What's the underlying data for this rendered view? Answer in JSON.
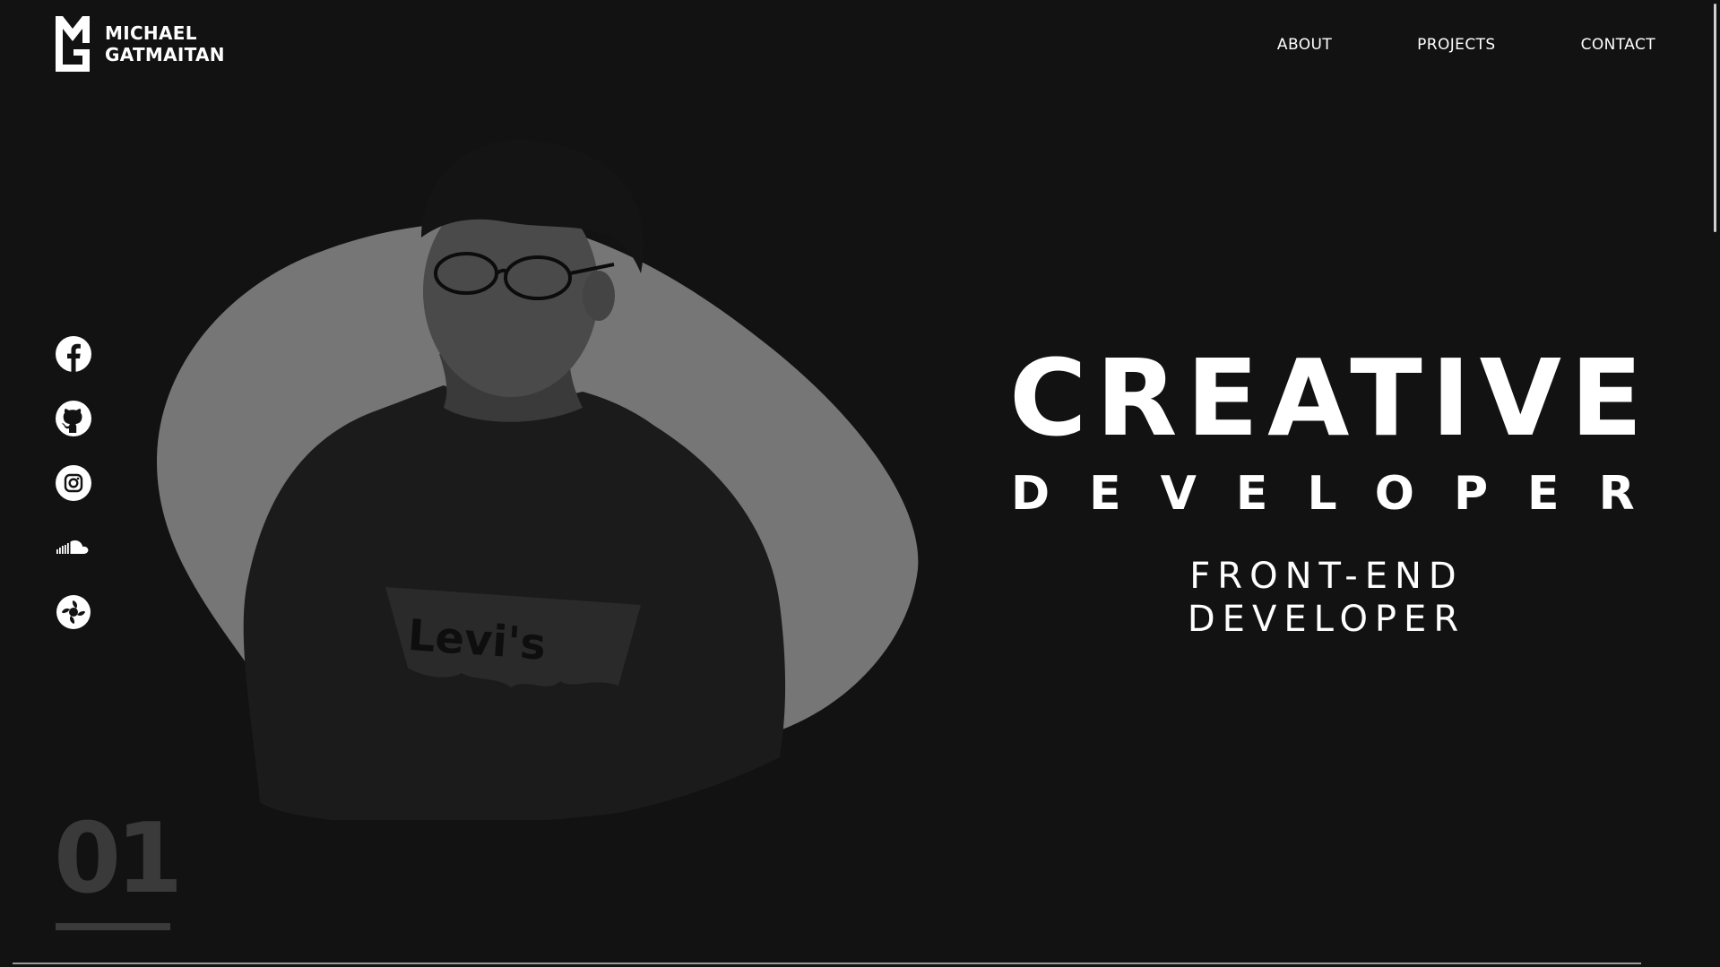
{
  "logo": {
    "first_name": "MICHAEL",
    "last_name": "GATMAITAN",
    "icon": "mg-monogram-icon"
  },
  "nav": {
    "items": [
      {
        "label": "ABOUT"
      },
      {
        "label": "PROJECTS"
      },
      {
        "label": "CONTACT"
      }
    ]
  },
  "social": {
    "items": [
      {
        "icon": "facebook-icon"
      },
      {
        "icon": "github-icon"
      },
      {
        "icon": "instagram-icon"
      },
      {
        "icon": "soundcloud-icon"
      },
      {
        "icon": "aperture-icon"
      }
    ]
  },
  "hero": {
    "headline": "CREATIVE",
    "subheadline": "DEVELOPER",
    "role_line1": "FRONT-END",
    "role_line2": "DEVELOPER",
    "photo_text": "Levi's"
  },
  "section": {
    "number": "01"
  },
  "colors": {
    "background": "#121212",
    "blob": "#767676",
    "text": "#ffffff",
    "muted": "#3a3a3a"
  }
}
